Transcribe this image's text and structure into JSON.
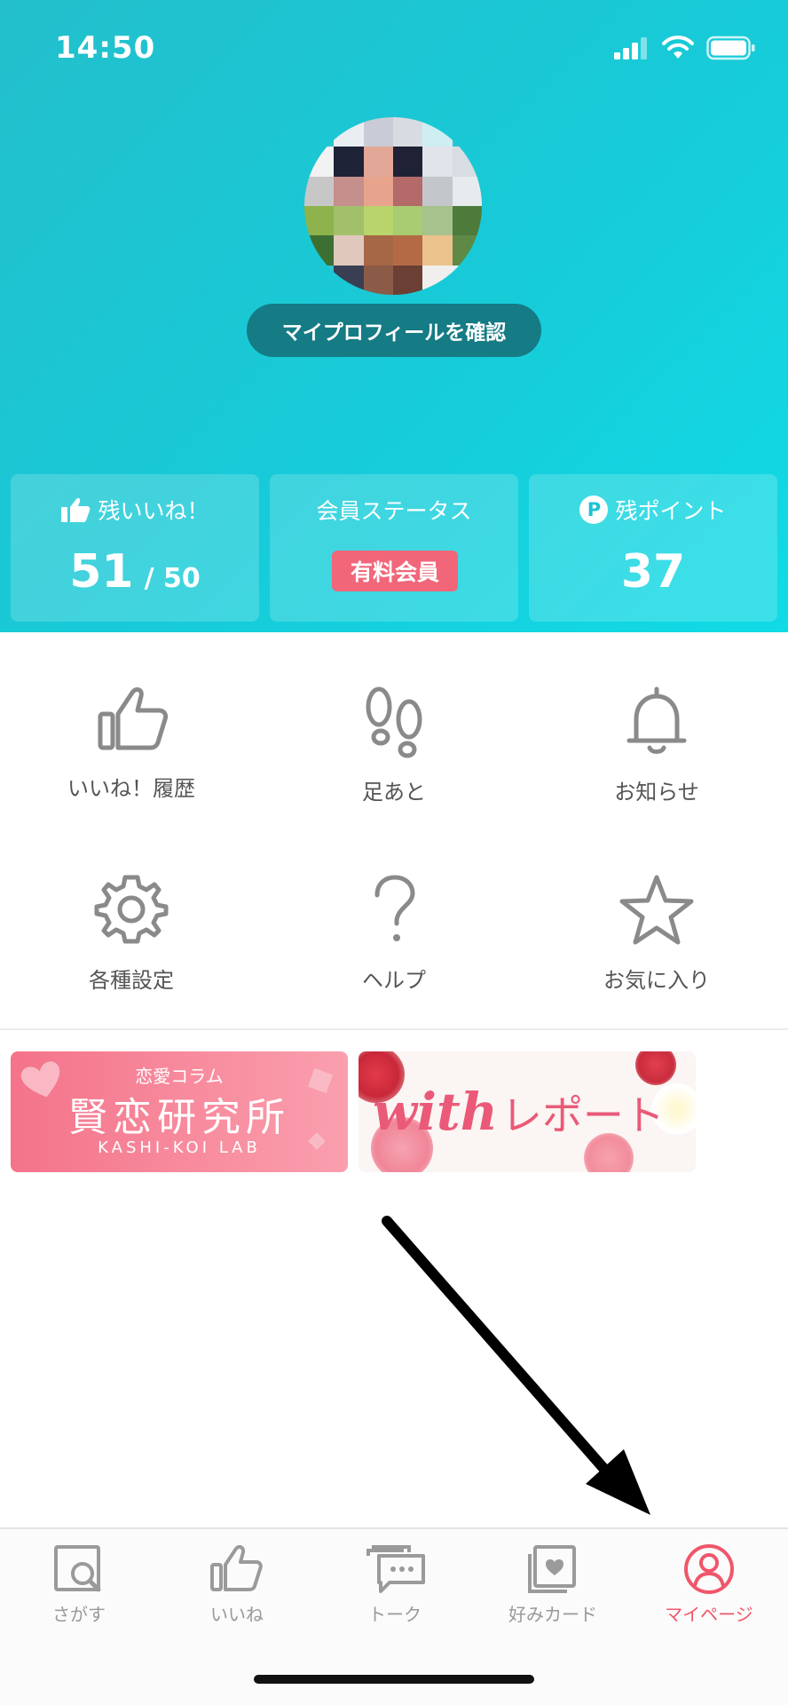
{
  "status_bar": {
    "time": "14:50"
  },
  "profile": {
    "button_label": "マイプロフィールを確認"
  },
  "stats": {
    "likes": {
      "title": "残いいね！",
      "value": "51",
      "max": "/ 50"
    },
    "membership": {
      "title": "会員ステータス",
      "badge": "有料会員"
    },
    "points": {
      "title": "残ポイント",
      "icon_letter": "P",
      "value": "37"
    }
  },
  "menu": [
    {
      "label": "いいね！履歴",
      "icon": "thumbs-up-icon"
    },
    {
      "label": "足あと",
      "icon": "footprints-icon"
    },
    {
      "label": "お知らせ",
      "icon": "bell-icon"
    },
    {
      "label": "各種設定",
      "icon": "gear-icon"
    },
    {
      "label": "ヘルプ",
      "icon": "question-mark-icon"
    },
    {
      "label": "お気に入り",
      "icon": "star-icon"
    }
  ],
  "banners": {
    "kashikoi": {
      "small": "恋愛コラム",
      "title": "賢恋研究所",
      "roman": "KASHI-KOI LAB"
    },
    "with_report": {
      "brand": "with",
      "title": "レポート"
    }
  },
  "tabs": [
    {
      "label": "さがす",
      "icon": "search-icon"
    },
    {
      "label": "いいね",
      "icon": "thumbs-up-icon"
    },
    {
      "label": "トーク",
      "icon": "chat-icon"
    },
    {
      "label": "好みカード",
      "icon": "card-icon"
    },
    {
      "label": "マイページ",
      "icon": "user-icon",
      "active": true
    }
  ],
  "colors": {
    "header": "#17cbd8",
    "accent": "#f0566a",
    "badge": "#f2667a"
  }
}
